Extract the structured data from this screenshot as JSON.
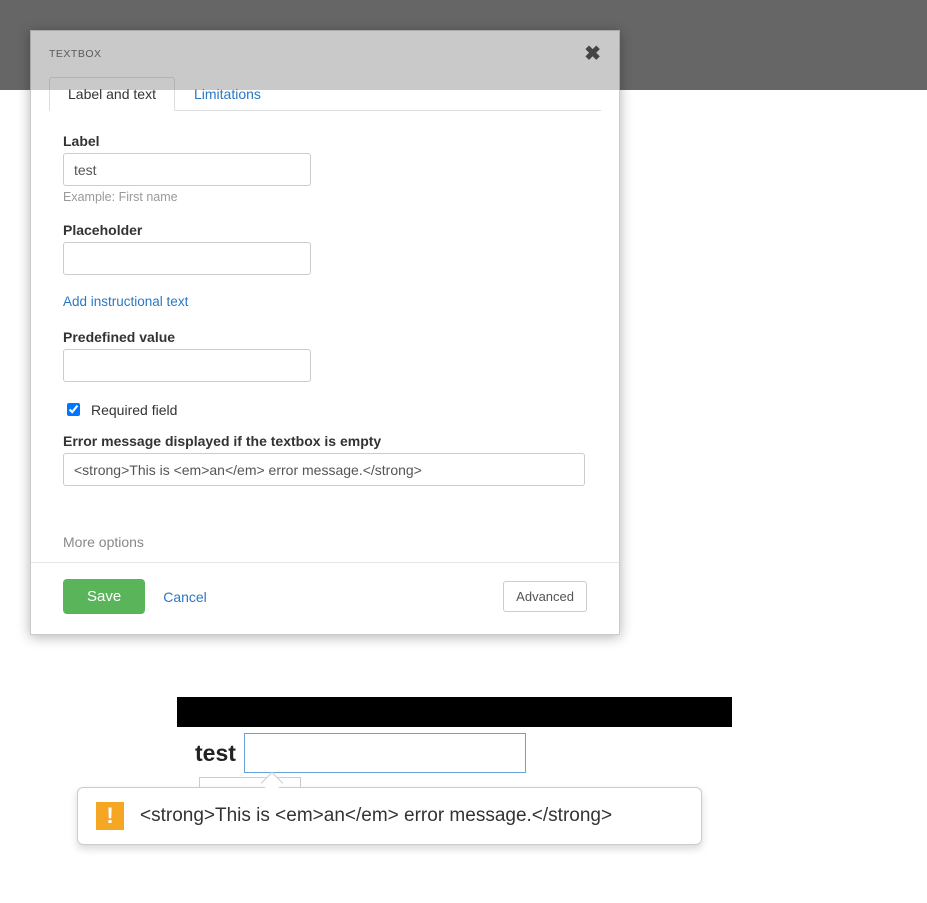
{
  "modal": {
    "type_label": "TEXTBOX",
    "tabs": {
      "label_and_text": "Label and text",
      "limitations": "Limitations"
    },
    "label": {
      "heading": "Label",
      "value": "test",
      "hint": "Example: First name"
    },
    "placeholder": {
      "heading": "Placeholder",
      "value": ""
    },
    "instruction_link": "Add instructional text",
    "predefined": {
      "heading": "Predefined value",
      "value": ""
    },
    "required": {
      "checked": true,
      "label": "Required field"
    },
    "error_msg": {
      "heading": "Error message displayed if the textbox is empty",
      "value": "<strong>This is <em>an</em> error message.</strong>"
    },
    "more_options": "More options",
    "save": "Save",
    "cancel": "Cancel",
    "advanced": "Advanced"
  },
  "preview": {
    "field_label": "test",
    "input_value": "",
    "tooltip_icon_symbol": "!",
    "tooltip_text": "<strong>This is <em>an</em> error message.</strong>"
  }
}
